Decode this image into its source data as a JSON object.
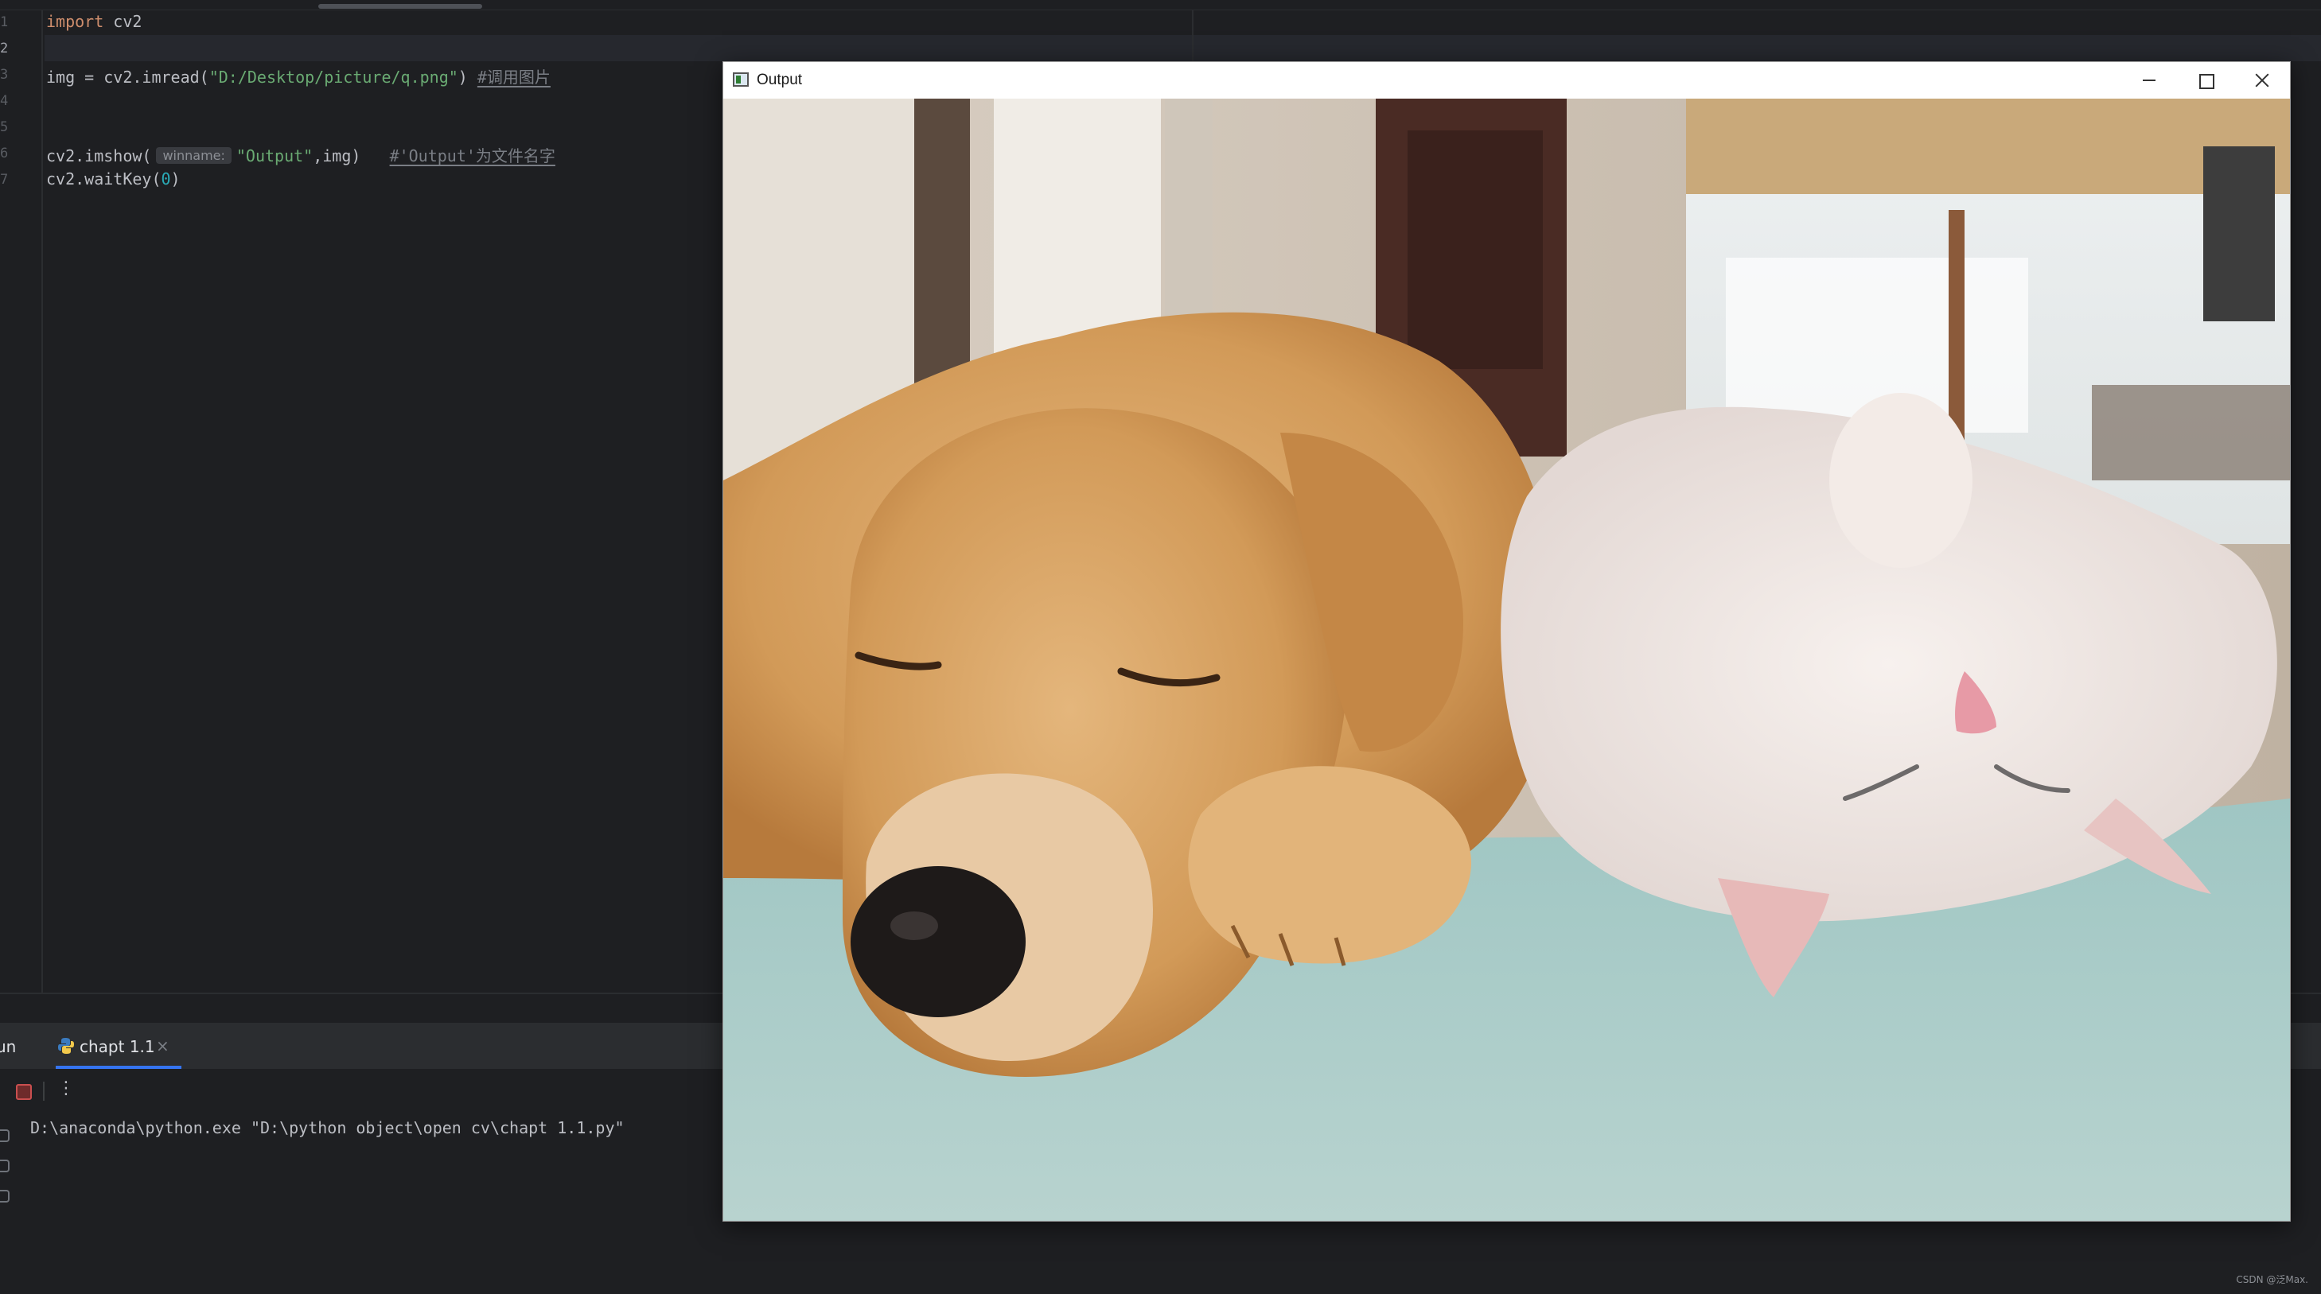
{
  "editor": {
    "line_numbers": [
      "1",
      "2",
      "3",
      "4",
      "5",
      "6",
      "7"
    ],
    "active_line": "2",
    "code": {
      "l1_keyword": "import",
      "l1_module": " cv2",
      "l3_prefix": "img = cv2.imread(",
      "l3_string": "\"D:/Desktop/picture/q.png\"",
      "l3_suffix": ")",
      "l3_comment": "#调用图片",
      "l6_prefix": "cv2.imshow(",
      "l6_hint": "winname:",
      "l6_string": "\"Output\"",
      "l6_suffix": ",img)",
      "l6_comment": "#'Output'为文件名字",
      "l7_prefix": "cv2.waitKey(",
      "l7_number": "0",
      "l7_suffix": ")"
    }
  },
  "run_panel": {
    "label": "Run",
    "tab_label": "chapt 1.1",
    "tab_icon": "python-icon",
    "console_output": "D:\\anaconda\\python.exe \"D:\\python object\\open cv\\chapt 1.1.py\""
  },
  "output_window": {
    "title": "Output",
    "image_description_icon": "photo",
    "controls": [
      "minimize-icon",
      "maximize-icon",
      "close-icon"
    ]
  },
  "watermark": "CSDN @泛Max.",
  "colors": {
    "editor_bg": "#1e1f22",
    "keyword": "#cf8e6d",
    "string": "#6aab73",
    "number": "#2aacb8",
    "comment": "#7a7e85",
    "tab_underline": "#3574f0",
    "stop": "#c94f4f"
  }
}
